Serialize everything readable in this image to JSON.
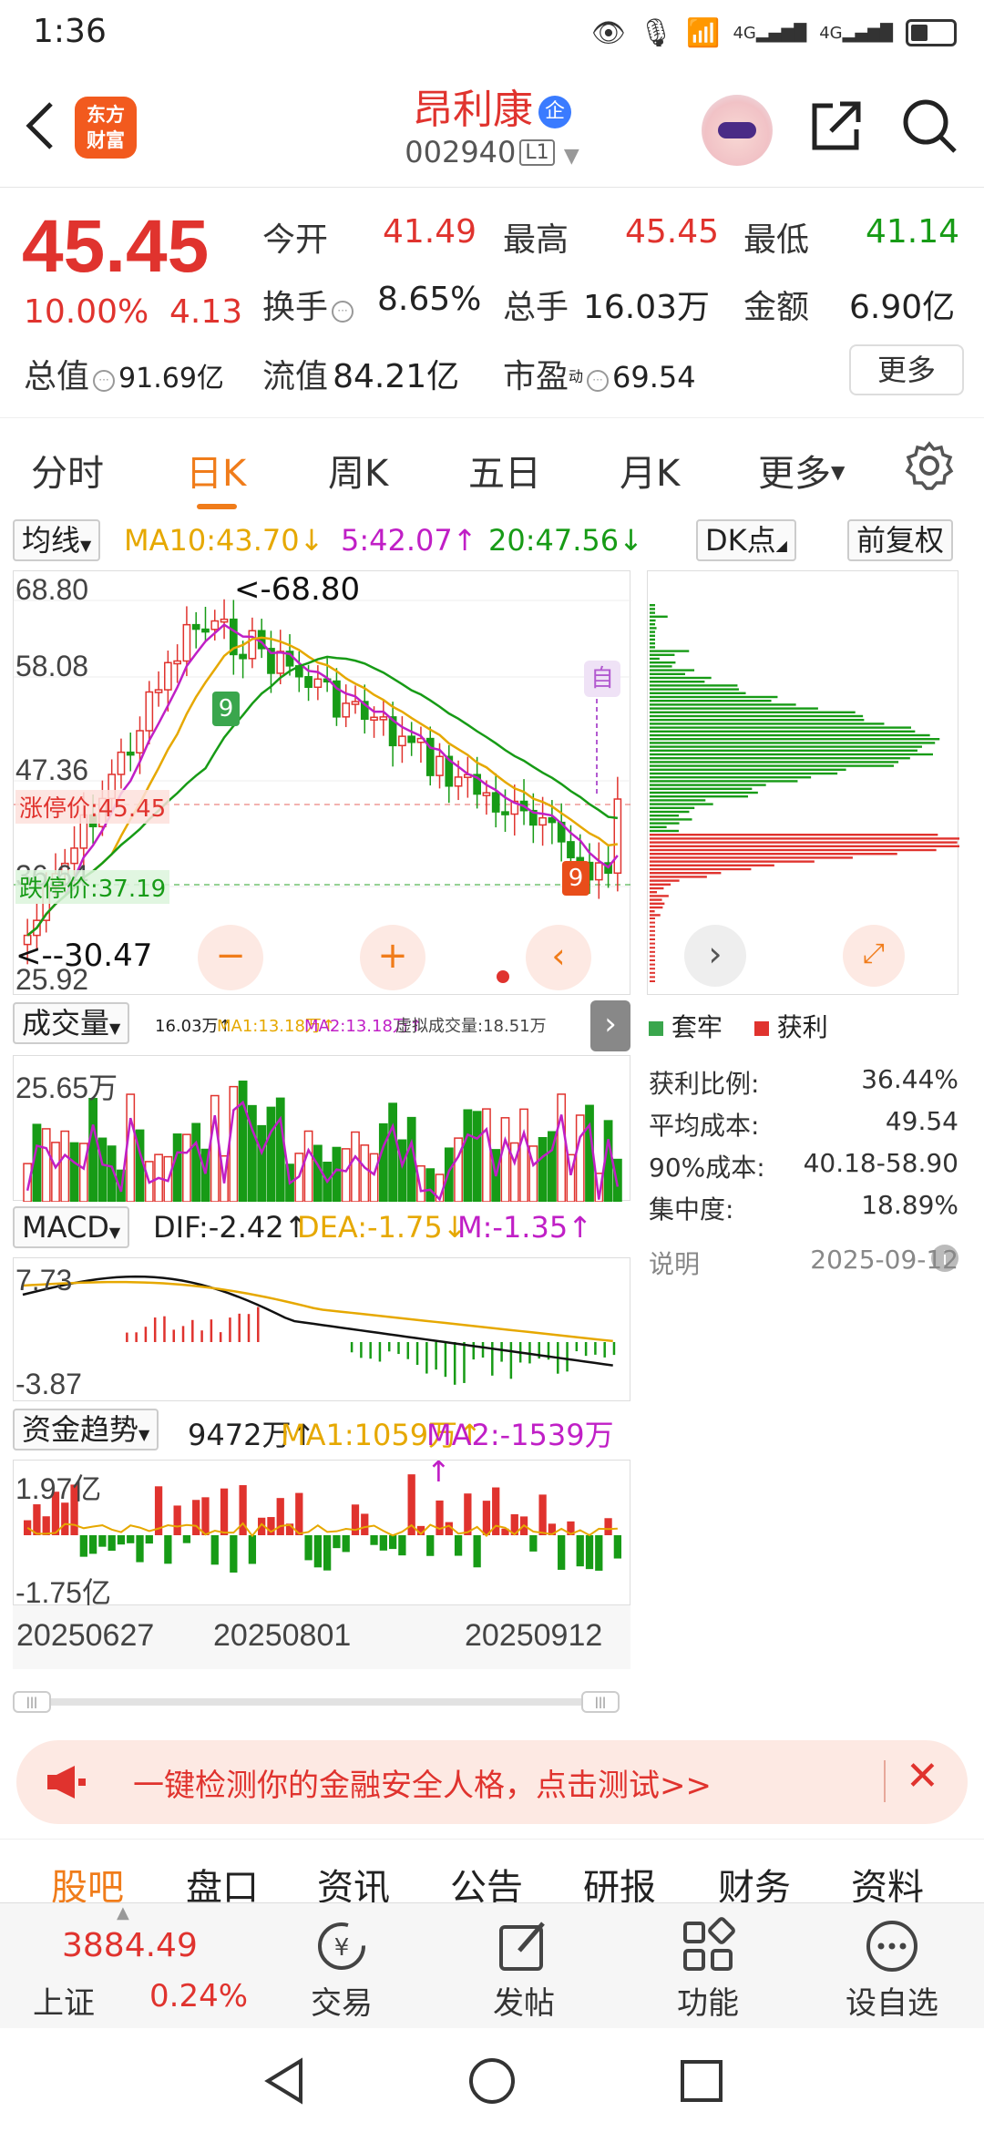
{
  "status_bar": {
    "time": "1:36",
    "net1": "4G",
    "net2": "4G"
  },
  "header": {
    "logo_line1": "东方",
    "logo_line2": "财富",
    "stock_name": "昂利康",
    "name_badge": "企",
    "stock_code": "002940",
    "level": "L1"
  },
  "quote": {
    "price": "45.45",
    "change_pct": "10.00%",
    "change_amt": "4.13",
    "open_label": "今开",
    "open": "41.49",
    "high_label": "最高",
    "high": "45.45",
    "low_label": "最低",
    "low": "41.14",
    "turnover_label": "换手",
    "turnover": "8.65%",
    "volume_label": "总手",
    "volume": "16.03万",
    "amount_label": "金额",
    "amount": "6.90亿",
    "total_value_label": "总值",
    "total_value": "91.69亿",
    "float_value_label": "流值",
    "float_value": "84.21亿",
    "pe_label": "市盈",
    "pe_sup": "动",
    "pe": "69.54",
    "more": "更多"
  },
  "tabs": [
    "分时",
    "日K",
    "周K",
    "五日",
    "月K",
    "更多"
  ],
  "ma": {
    "selector": "均线",
    "ma10": "MA10:43.70↓",
    "ma5": "5:42.07↑",
    "ma20": "20:47.56↓",
    "dk": "DK点",
    "adjust": "前复权"
  },
  "kline": {
    "y_labels": [
      "68.80",
      "58.08",
      "47.36",
      "36.64",
      "25.92"
    ],
    "high_marker": "<-68.80",
    "low_marker": "<--30.47",
    "limit_up": "涨停价:45.45",
    "limit_down": "跌停价:37.19",
    "auto_label": "自",
    "nine_turn_top": "9",
    "nine_turn_bottom": "9"
  },
  "volume": {
    "selector": "成交量",
    "val": "16.03万↑",
    "ma1": "MA1:13.18万↑",
    "ma2": "MA2:13.18万↑",
    "virtual": "虚拟成交量:18.51万",
    "y_label": "25.65万"
  },
  "macd": {
    "selector": "MACD",
    "dif": "DIF:-2.42↑",
    "dea": "DEA:-1.75↓",
    "m": "M:-1.35↑",
    "y_top": "7.73",
    "y_bottom": "-3.87"
  },
  "fund": {
    "selector": "资金趋势",
    "val": "9472万↑",
    "ma1": "MA1:1059万↑",
    "ma2": "MA2:-1539万↑",
    "y_top": "1.97亿",
    "y_bottom": "-1.75亿"
  },
  "dates": [
    "20250627",
    "20250801",
    "20250912"
  ],
  "chips": {
    "legend_locked": "套牢",
    "legend_profit": "获利",
    "stats": [
      {
        "label": "获利比例:",
        "value": "36.44%"
      },
      {
        "label": "平均成本:",
        "value": "49.54"
      },
      {
        "label": "90%成本:",
        "value": "40.18-58.90"
      },
      {
        "label": "集中度:",
        "value": "18.89%"
      }
    ],
    "note_label": "说明",
    "note_date": "2025-09-12"
  },
  "ad": {
    "text": "一键检测你的金融安全人格，点击测试>>"
  },
  "sub_tabs": [
    "股吧",
    "盘口",
    "资讯",
    "公告",
    "研报",
    "财务",
    "资料"
  ],
  "bottom_bar": {
    "index_value": "3884.49",
    "index_name": "上证",
    "index_pct": "0.24%",
    "trade": "交易",
    "post": "发帖",
    "functions": "功能",
    "watchlist": "设自选"
  },
  "colors": {
    "up": "#e0332e",
    "down": "#179b16",
    "accent": "#f07c1a"
  }
}
